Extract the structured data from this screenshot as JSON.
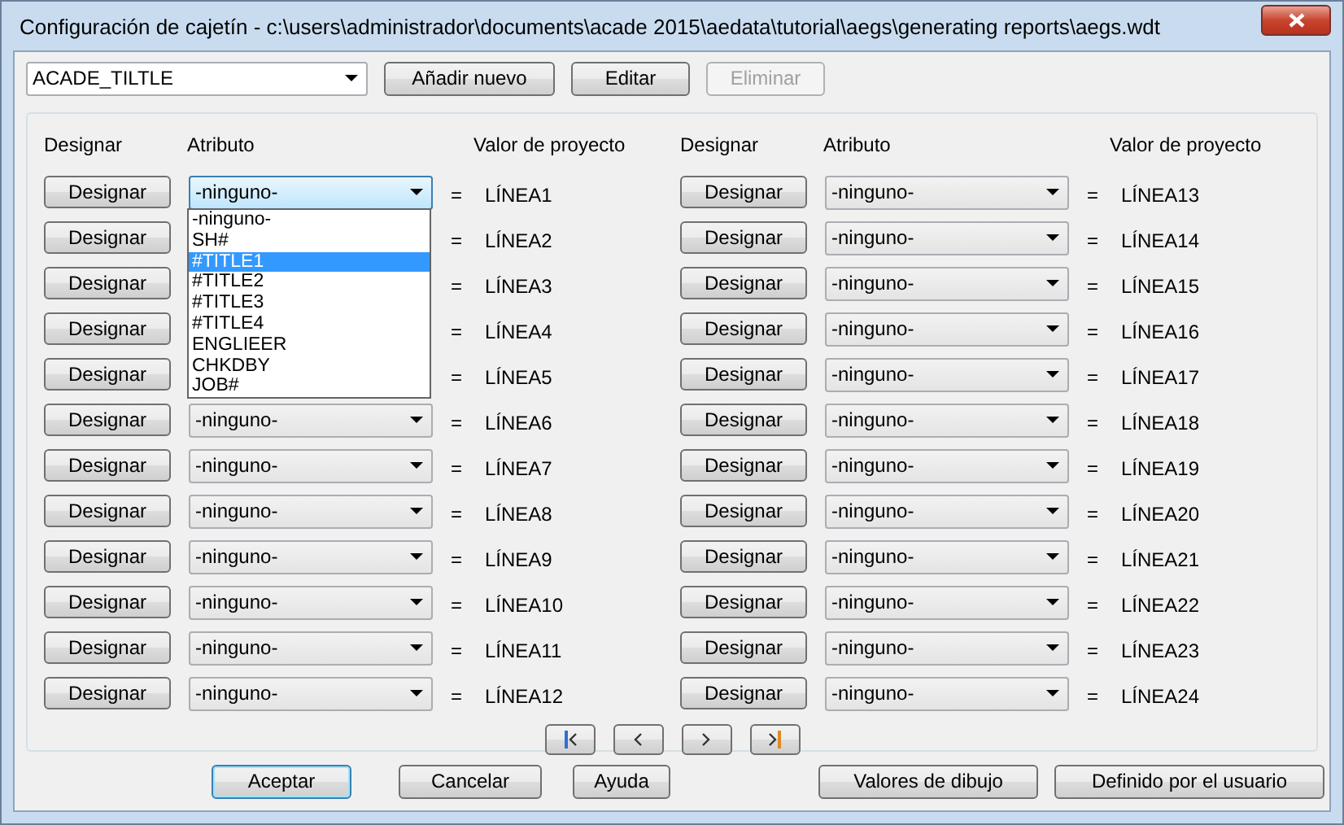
{
  "window": {
    "title": "Configuración de cajetín - c:\\users\\administrador\\documents\\acade 2015\\aedata\\tutorial\\aegs\\generating reports\\aegs.wdt"
  },
  "template": {
    "value": "ACADE_TILTLE"
  },
  "top_buttons": [
    {
      "label": "Añadir nuevo",
      "disabled": false
    },
    {
      "label": "Editar",
      "disabled": false
    },
    {
      "label": "Eliminar",
      "disabled": true
    }
  ],
  "columns": [
    {
      "headers": [
        "Designar",
        "Atributo",
        "Valor de proyecto"
      ],
      "rows": [
        {
          "button": "Designar",
          "attribute": "-ninguno-",
          "equals": "=",
          "value": "LÍNEA1",
          "expanded": true,
          "options": [
            {
              "label": "-ninguno-",
              "selected": false
            },
            {
              "label": "SH#",
              "selected": false
            },
            {
              "label": "#TITLE1",
              "selected": true
            },
            {
              "label": "#TITLE2",
              "selected": false
            },
            {
              "label": "#TITLE3",
              "selected": false
            },
            {
              "label": "#TITLE4",
              "selected": false
            },
            {
              "label": "ENGLIEER",
              "selected": false
            },
            {
              "label": "CHKDBY",
              "selected": false
            },
            {
              "label": "JOB#",
              "selected": false
            }
          ]
        },
        {
          "button": "Designar",
          "equals": "=",
          "value": "LÍNEA2"
        },
        {
          "button": "Designar",
          "equals": "=",
          "value": "LÍNEA3"
        },
        {
          "button": "Designar",
          "equals": "=",
          "value": "LÍNEA4"
        },
        {
          "button": "Designar",
          "equals": "=",
          "value": "LÍNEA5"
        },
        {
          "button": "Designar",
          "attribute": "-ninguno-",
          "equals": "=",
          "value": "LÍNEA6",
          "expanded": false
        },
        {
          "button": "Designar",
          "attribute": "-ninguno-",
          "equals": "=",
          "value": "LÍNEA7",
          "expanded": false
        },
        {
          "button": "Designar",
          "attribute": "-ninguno-",
          "equals": "=",
          "value": "LÍNEA8",
          "expanded": false
        },
        {
          "button": "Designar",
          "attribute": "-ninguno-",
          "equals": "=",
          "value": "LÍNEA9",
          "expanded": false
        },
        {
          "button": "Designar",
          "attribute": "-ninguno-",
          "equals": "=",
          "value": "LÍNEA10",
          "expanded": false
        },
        {
          "button": "Designar",
          "attribute": "-ninguno-",
          "equals": "=",
          "value": "LÍNEA11",
          "expanded": false
        },
        {
          "button": "Designar",
          "attribute": "-ninguno-",
          "equals": "=",
          "value": "LÍNEA12",
          "expanded": false
        }
      ]
    },
    {
      "headers": [
        "Designar",
        "Atributo",
        "Valor de proyecto"
      ],
      "rows": [
        {
          "button": "Designar",
          "attribute": "-ninguno-",
          "equals": "=",
          "value": "LÍNEA13",
          "expanded": false
        },
        {
          "button": "Designar",
          "attribute": "-ninguno-",
          "equals": "=",
          "value": "LÍNEA14",
          "expanded": false
        },
        {
          "button": "Designar",
          "attribute": "-ninguno-",
          "equals": "=",
          "value": "LÍNEA15",
          "expanded": false
        },
        {
          "button": "Designar",
          "attribute": "-ninguno-",
          "equals": "=",
          "value": "LÍNEA16",
          "expanded": false
        },
        {
          "button": "Designar",
          "attribute": "-ninguno-",
          "equals": "=",
          "value": "LÍNEA17",
          "expanded": false
        },
        {
          "button": "Designar",
          "attribute": "-ninguno-",
          "equals": "=",
          "value": "LÍNEA18",
          "expanded": false
        },
        {
          "button": "Designar",
          "attribute": "-ninguno-",
          "equals": "=",
          "value": "LÍNEA19",
          "expanded": false
        },
        {
          "button": "Designar",
          "attribute": "-ninguno-",
          "equals": "=",
          "value": "LÍNEA20",
          "expanded": false
        },
        {
          "button": "Designar",
          "attribute": "-ninguno-",
          "equals": "=",
          "value": "LÍNEA21",
          "expanded": false
        },
        {
          "button": "Designar",
          "attribute": "-ninguno-",
          "equals": "=",
          "value": "LÍNEA22",
          "expanded": false
        },
        {
          "button": "Designar",
          "attribute": "-ninguno-",
          "equals": "=",
          "value": "LÍNEA23",
          "expanded": false
        },
        {
          "button": "Designar",
          "attribute": "-ninguno-",
          "equals": "=",
          "value": "LÍNEA24",
          "expanded": false
        }
      ]
    }
  ],
  "pager": [
    {
      "kind": "first"
    },
    {
      "kind": "previous"
    },
    {
      "kind": "next"
    },
    {
      "kind": "last"
    }
  ],
  "bottom_buttons": [
    {
      "label": "Aceptar",
      "default": true
    },
    {
      "label": "Cancelar",
      "default": false
    },
    {
      "label": "Ayuda",
      "default": false
    },
    {
      "label": "Valores de dibujo",
      "default": false
    },
    {
      "label": "Definido por el usuario",
      "default": false
    }
  ]
}
